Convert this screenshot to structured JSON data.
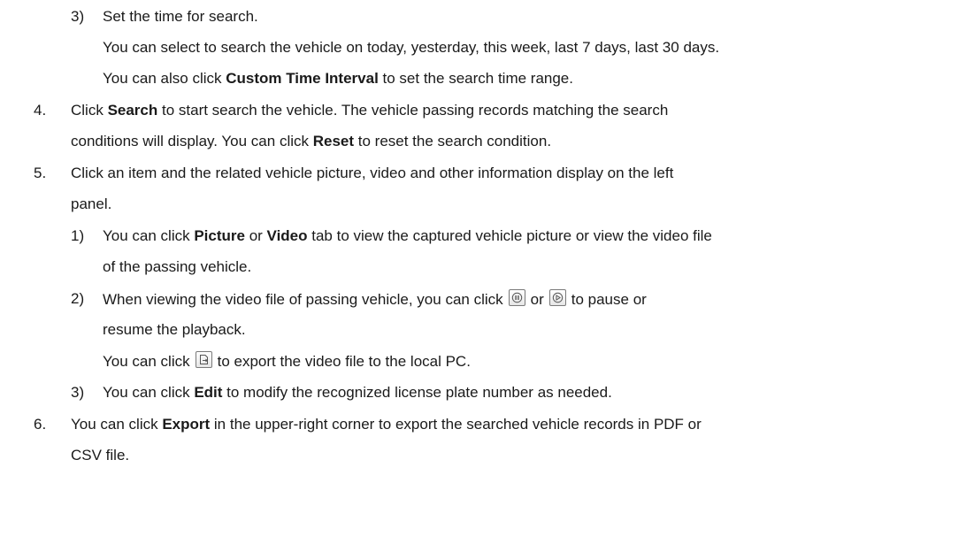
{
  "doc": {
    "s3": {
      "num": "3)",
      "text": "Set the time for search.",
      "line2": "You can select to search the vehicle on today, yesterday, this week, last 7 days, last 30 days.",
      "line3_pre": "You can also click ",
      "line3_bold": "Custom Time Interval",
      "line3_post": " to set the search time range."
    },
    "s4": {
      "num": "4.",
      "line1_pre": "Click ",
      "line1_bold": "Search",
      "line1_post": " to start search the vehicle. The vehicle passing records matching the search",
      "line2_pre": "conditions will display. You can click ",
      "line2_bold": "Reset",
      "line2_post": " to reset the search condition."
    },
    "s5": {
      "num": "5.",
      "line1": "Click an item and the related vehicle picture, video and other information display on the left",
      "line2": "panel.",
      "sub1": {
        "num": "1)",
        "line1_a": "You can click ",
        "line1_b": "Picture",
        "line1_c": " or ",
        "line1_d": "Video",
        "line1_e": " tab to view the captured vehicle picture or view the video file",
        "line2": "of the passing vehicle."
      },
      "sub2": {
        "num": "2)",
        "line1_a": "When viewing the video file of passing vehicle, you can click",
        "line1_b": "or",
        "line1_c": "to pause or",
        "line2": "resume the playback.",
        "line3_a": "You can click",
        "line3_b": "to export the video file to the local PC."
      },
      "sub3": {
        "num": "3)",
        "pre": "You can click ",
        "bold": "Edit",
        "post": " to modify the recognized license plate number as needed."
      }
    },
    "s6": {
      "num": "6.",
      "line1_pre": "You can click ",
      "line1_bold": "Export",
      "line1_post": " in the upper-right corner to export the searched vehicle records in PDF or",
      "line2": "CSV file."
    },
    "icons": {
      "pause": "pause-icon",
      "play": "play-icon",
      "export": "export-icon"
    }
  }
}
